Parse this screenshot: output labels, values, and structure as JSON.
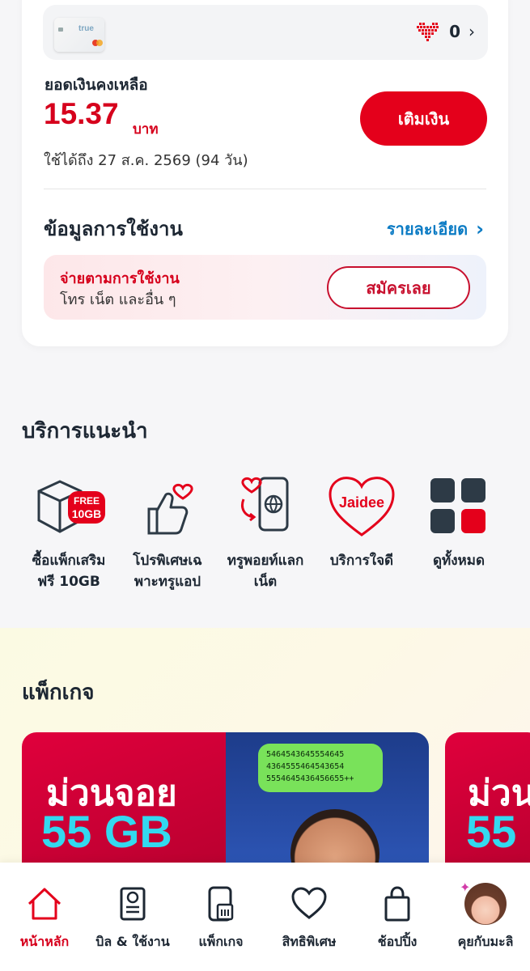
{
  "card": {
    "brand_text": "true",
    "points_value": "0",
    "points_chevron": "›"
  },
  "balance": {
    "label": "ยอดเงินคงเหลือ",
    "amount": "15.37",
    "unit": "บาท",
    "validity": "ใช้ได้ถึง 27 ส.ค. 2569 (94 วัน)",
    "topup_label": "เติมเงิน"
  },
  "usage": {
    "title": "ข้อมูลการใช้งาน",
    "detail_label": "รายละเอียด",
    "detail_chevron": "›",
    "payg_title": "จ่ายตามการใช้งาน",
    "payg_subtitle": "โทร เน็ต และอื่น ๆ",
    "payg_button": "สมัครเลย"
  },
  "services": {
    "title": "บริการแนะนำ",
    "items": [
      {
        "line1": "ซื้อแพ็กเสริม",
        "line2": "ฟรี 10GB",
        "icon": "box-free-icon",
        "badge1": "FREE",
        "badge2": "10GB"
      },
      {
        "line1": "โปรพิเศษเฉ",
        "line2": "พาะทรูแอป",
        "icon": "thumbs-up-heart-icon"
      },
      {
        "line1": "ทรูพอยท์แลก",
        "line2": "เน็ต",
        "icon": "phone-exchange-icon"
      },
      {
        "line1": "บริการใจดี",
        "line2": "",
        "icon": "jaidee-heart-icon",
        "badge1": "Jaidee"
      },
      {
        "line1": "ดูทั้งหมด",
        "line2": "",
        "icon": "grid-icon"
      }
    ]
  },
  "packages": {
    "title": "แพ็กเกจ",
    "banner_title": "ม่วนจอย",
    "banner_amount": "55 GB",
    "bubble_lines": [
      "5464543645554645",
      "4364555464543654",
      "5554645436456655++"
    ]
  },
  "nav": {
    "items": [
      {
        "label": "หน้าหลัก",
        "icon": "home-icon",
        "active": true
      },
      {
        "label": "บิล & ใช้งาน",
        "icon": "bill-icon",
        "active": false
      },
      {
        "label": "แพ็กเกจ",
        "icon": "package-sim-icon",
        "active": false
      },
      {
        "label": "สิทธิพิเศษ",
        "icon": "heart-icon",
        "active": false
      },
      {
        "label": "ช้อปปิ้ง",
        "icon": "shopping-bag-icon",
        "active": false
      },
      {
        "label": "คุยกับมะลิ",
        "icon": "avatar-icon",
        "active": false
      }
    ]
  },
  "colors": {
    "accent_red": "#e4001b",
    "link_blue": "#0b7bc4",
    "text_dark": "#1d2733"
  }
}
